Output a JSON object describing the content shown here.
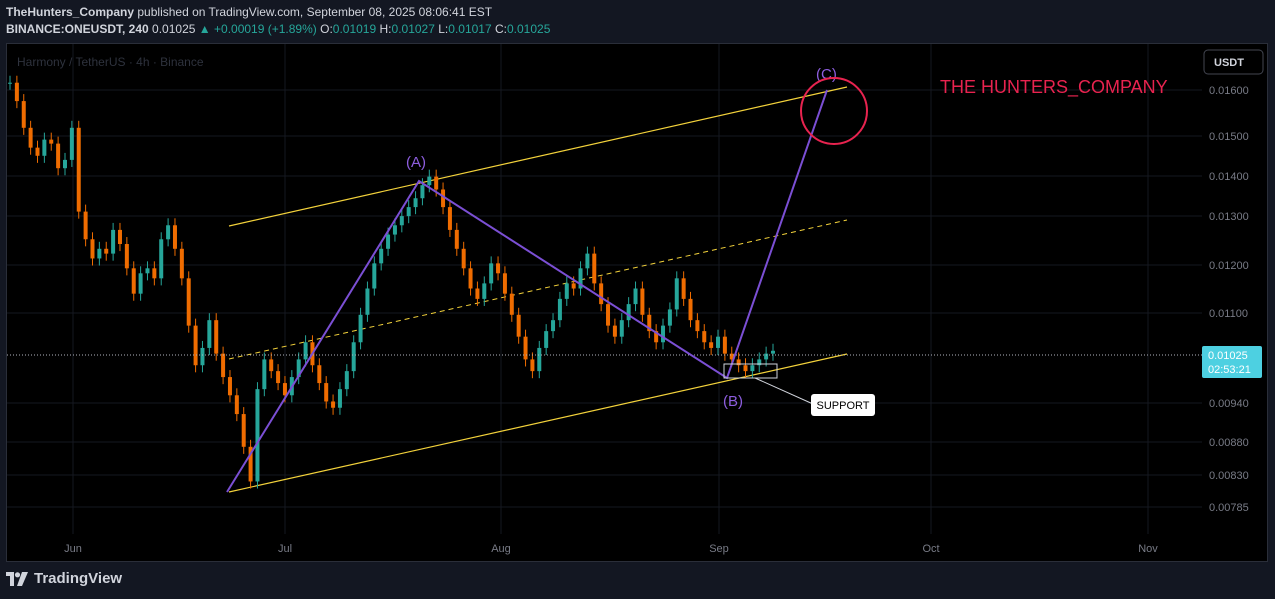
{
  "header": {
    "author": "TheHunters_Company",
    "published_text": "published on TradingView.com, September 08, 2025 08:06:41 EST",
    "symbol": "BINANCE:ONEUSDT, 240",
    "last": "0.01025",
    "change": "+0.00019 (+1.89%)",
    "o_label": "O:",
    "o": "0.01019",
    "h_label": "H:",
    "h": "0.01027",
    "l_label": "L:",
    "l": "0.01017",
    "c_label": "C:",
    "c": "0.01025"
  },
  "footer": {
    "brand": "TradingView"
  },
  "chart_data": {
    "type": "candlestick",
    "watermark": "Harmony / TetherUS · 4h · Binance",
    "currency_button": "USDT",
    "brand_text": "THE HUNTERS_COMPANY",
    "y_ticks": [
      "0.01600",
      "0.01500",
      "0.01400",
      "0.01300",
      "0.01200",
      "0.01100",
      "0.00940",
      "0.00880",
      "0.00830",
      "0.00785"
    ],
    "x_ticks": [
      "Jun",
      "Jul",
      "Aug",
      "Sep",
      "Oct",
      "Nov"
    ],
    "price_tag": {
      "value": "0.01025",
      "countdown": "02:53:21"
    },
    "wave_labels": [
      "(A)",
      "(B)",
      "(C)"
    ],
    "support_label": "SUPPORT",
    "close_series": [
      0.0162,
      0.0157,
      0.015,
      0.0145,
      0.0143,
      0.0147,
      0.0146,
      0.014,
      0.0142,
      0.015,
      0.013,
      0.0124,
      0.012,
      0.0122,
      0.0121,
      0.0126,
      0.0123,
      0.0118,
      0.0113,
      0.0117,
      0.0118,
      0.0116,
      0.0124,
      0.0127,
      0.0122,
      0.0116,
      0.0107,
      0.01,
      0.0103,
      0.0108,
      0.0102,
      0.0098,
      0.0095,
      0.0092,
      0.0087,
      0.0082,
      0.0096,
      0.0101,
      0.0099,
      0.0097,
      0.0095,
      0.0098,
      0.0101,
      0.0104,
      0.01,
      0.0097,
      0.0094,
      0.0093,
      0.0096,
      0.0099,
      0.0104,
      0.0109,
      0.0114,
      0.0119,
      0.0122,
      0.0125,
      0.0127,
      0.0129,
      0.0131,
      0.0133,
      0.0136,
      0.0138,
      0.0135,
      0.0131,
      0.0126,
      0.0122,
      0.0118,
      0.0114,
      0.0112,
      0.0115,
      0.0119,
      0.0117,
      0.0113,
      0.0109,
      0.0105,
      0.0101,
      0.0099,
      0.0103,
      0.0106,
      0.0108,
      0.0112,
      0.0115,
      0.0114,
      0.0118,
      0.0121,
      0.0115,
      0.0111,
      0.0107,
      0.0105,
      0.0108,
      0.0111,
      0.0114,
      0.0109,
      0.0106,
      0.0104,
      0.0107,
      0.011,
      0.0116,
      0.0112,
      0.0108,
      0.0106,
      0.0104,
      0.0103,
      0.0105,
      0.0102,
      0.0101,
      0.01,
      0.0099,
      0.01,
      0.0101,
      0.0102,
      0.01025
    ],
    "series": [
      {
        "name": "(A)",
        "points": [
          [
            "2025-06-23",
            0.0081
          ],
          [
            "2025-07-20",
            0.0139
          ]
        ]
      },
      {
        "name": "(B)",
        "points": [
          [
            "2025-09-01",
            0.01
          ]
        ]
      },
      {
        "name": "(C)",
        "points": [
          [
            "2025-09-19",
            0.016
          ]
        ]
      }
    ],
    "colors": {
      "up": "#26a69a",
      "down": "#ef6c00",
      "channel": "#f3d23b",
      "wave": "#7b4fd4",
      "brand": "#e8234f",
      "tag": "#4dd0e1"
    }
  }
}
